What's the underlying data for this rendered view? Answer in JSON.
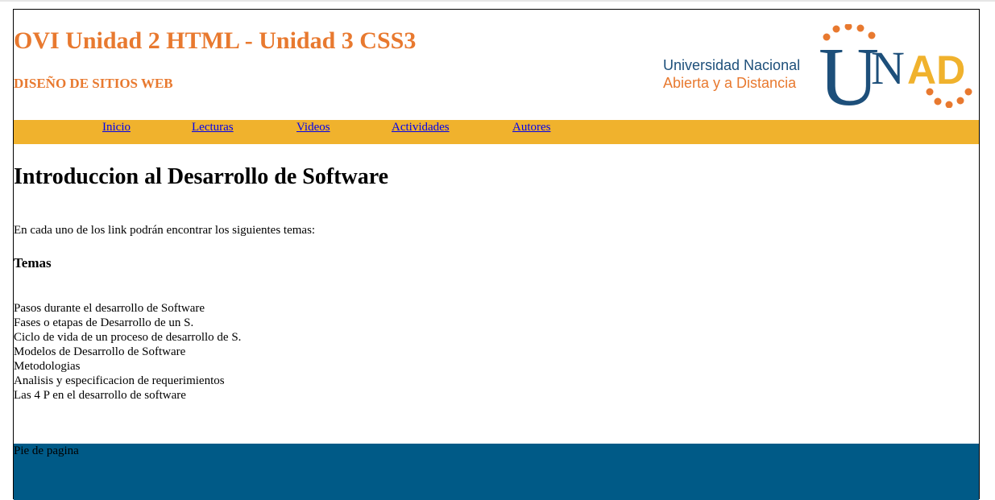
{
  "header": {
    "title": "OVI Unidad 2 HTML - Unidad 3 CSS3",
    "subtitle": "DISEÑO DE SITIOS WEB",
    "logo": {
      "line1": "Universidad Nacional",
      "line2": "Abierta y a Distancia",
      "mark_text_u": "U",
      "mark_text_n": "N",
      "mark_text_ad": "AD",
      "colors": {
        "blue": "#1d4f7a",
        "orange": "#e8792f",
        "yellow": "#f0b22d"
      }
    }
  },
  "nav": {
    "background": "#f0b22d",
    "items": [
      {
        "label": "Inicio"
      },
      {
        "label": "Lecturas"
      },
      {
        "label": "Videos"
      },
      {
        "label": "Actividades"
      },
      {
        "label": "Autores"
      }
    ]
  },
  "main": {
    "heading": "Introduccion al Desarrollo de Software",
    "intro": "En cada uno de los link podrán encontrar los siguientes temas:",
    "topics_heading": "Temas",
    "topics": [
      "Pasos durante el desarrollo de Software",
      "Fases o etapas de Desarrollo de un S.",
      "Ciclo de vida de un proceso de desarrollo de S.",
      "Modelos de Desarrollo de Software",
      "Metodologias",
      "Analisis y especificacion de requerimientos",
      "Las 4 P en el desarrollo de software"
    ]
  },
  "footer": {
    "text": "Pie de pagina",
    "background": "#005a87"
  }
}
